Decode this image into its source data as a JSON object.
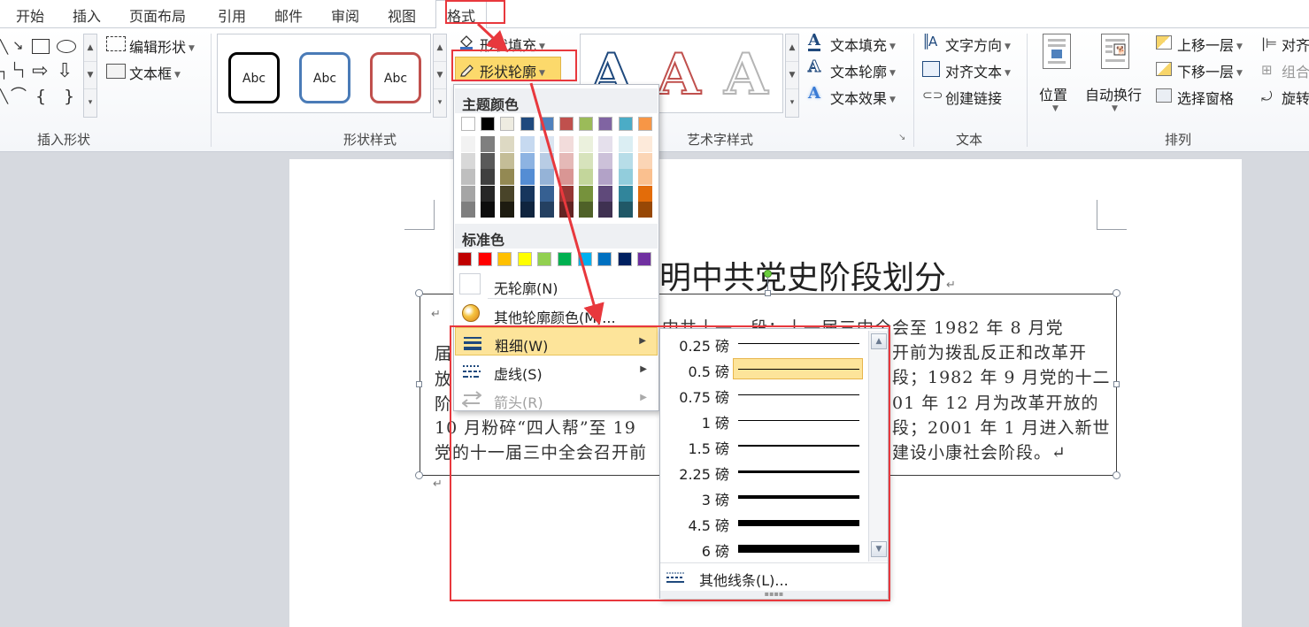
{
  "tabs": [
    "开始",
    "插入",
    "页面布局",
    "引用",
    "邮件",
    "审阅",
    "视图",
    "格式"
  ],
  "active_tab": "格式",
  "ribbon": {
    "insert_shapes": {
      "label": "插入形状",
      "edit_shape": "编辑形状",
      "text_box": "文本框"
    },
    "shape_styles": {
      "label": "形状样式",
      "samples": [
        "Abc",
        "Abc",
        "Abc"
      ],
      "shape_fill": "形状填充",
      "shape_outline": "形状轮廓"
    },
    "wordart_styles": {
      "label": "艺术字样式",
      "letter": "A",
      "text_fill": "文本填充",
      "text_outline": "文本轮廓",
      "text_effects": "文本效果"
    },
    "text": {
      "label": "文本",
      "text_direction": "文字方向",
      "align_text": "对齐文本",
      "create_link": "创建链接"
    },
    "arrange": {
      "label": "排列",
      "position": "位置",
      "wrap_text": "自动换行",
      "bring_forward": "上移一层",
      "send_backward": "下移一层",
      "selection_pane": "选择窗格",
      "align": "对齐",
      "group": "组合",
      "rotate": "旋转"
    }
  },
  "document": {
    "title": "明中共党史阶段划分",
    "pilcrow": "↵",
    "lines": [
      {
        "left": "届",
        "right": "中共十一　段：十一届三中全会至 1982 年 8 月党"
      },
      {
        "left": "放",
        "right": "开前为拨乱反正和改革开"
      },
      {
        "left": "阶",
        "right": "段；1982 年 9 月党的十二"
      },
      {
        "left": "10 月粉碎“四人帮”至 19",
        "right": "01 年 12 月为改革开放的"
      },
      {
        "left": "党的十一届三中全会召开前",
        "right": "段；2001 年 1 月进入新世"
      },
      {
        "left": "",
        "right": "建设小康社会阶段。↵"
      }
    ]
  },
  "outline_menu": {
    "theme_colors_header": "主题颜色",
    "standard_colors_header": "标准色",
    "no_outline": "无轮廓(N)",
    "more_colors": "其他轮廓颜色(M)...",
    "weight": "粗细(W)",
    "dashes": "虚线(S)",
    "arrows": "箭头(R)",
    "theme_top": [
      "#ffffff",
      "#000000",
      "#eeece1",
      "#1f497d",
      "#4f81bd",
      "#c0504d",
      "#9bbb59",
      "#8064a2",
      "#4bacc6",
      "#f79646"
    ],
    "theme_shades": [
      [
        "#f2f2f2",
        "#d8d8d8",
        "#bfbfbf",
        "#a5a5a5",
        "#7f7f7f"
      ],
      [
        "#7f7f7f",
        "#595959",
        "#3f3f3f",
        "#262626",
        "#0c0c0c"
      ],
      [
        "#ddd9c3",
        "#c4bd97",
        "#938953",
        "#494429",
        "#1d1b10"
      ],
      [
        "#c6d9f0",
        "#8db3e2",
        "#548dd4",
        "#17365d",
        "#0f243e"
      ],
      [
        "#dbe5f1",
        "#b8cce4",
        "#95b3d7",
        "#366092",
        "#244061"
      ],
      [
        "#f2dcdb",
        "#e5b9b7",
        "#d99694",
        "#953734",
        "#632423"
      ],
      [
        "#ebf1dd",
        "#d7e3bc",
        "#c3d69b",
        "#76923c",
        "#4f6128"
      ],
      [
        "#e5e0ec",
        "#ccc1d9",
        "#b2a2c7",
        "#5f497a",
        "#3f3151"
      ],
      [
        "#dbeef3",
        "#b7dde8",
        "#92cddc",
        "#31859b",
        "#205867"
      ],
      [
        "#fdeada",
        "#fbd5b5",
        "#fac08f",
        "#e36c09",
        "#974806"
      ]
    ],
    "standard": [
      "#c00000",
      "#ff0000",
      "#ffc000",
      "#ffff00",
      "#92d050",
      "#00b050",
      "#00b0f0",
      "#0070c0",
      "#002060",
      "#7030a0"
    ]
  },
  "weight_menu": {
    "items": [
      {
        "label": "0.25 磅",
        "weight_pt": 0.25
      },
      {
        "label": "0.5 磅",
        "weight_pt": 0.5,
        "selected": true
      },
      {
        "label": "0.75 磅",
        "weight_pt": 0.75
      },
      {
        "label": "1 磅",
        "weight_pt": 1
      },
      {
        "label": "1.5 磅",
        "weight_pt": 1.5
      },
      {
        "label": "2.25 磅",
        "weight_pt": 2.25
      },
      {
        "label": "3 磅",
        "weight_pt": 3
      },
      {
        "label": "4.5 磅",
        "weight_pt": 4.5
      },
      {
        "label": "6 磅",
        "weight_pt": 6
      }
    ],
    "more_lines": "其他线条(L)..."
  },
  "colors": {
    "annotation_red": "#e8383d",
    "hover_fill": "#fde49a"
  }
}
